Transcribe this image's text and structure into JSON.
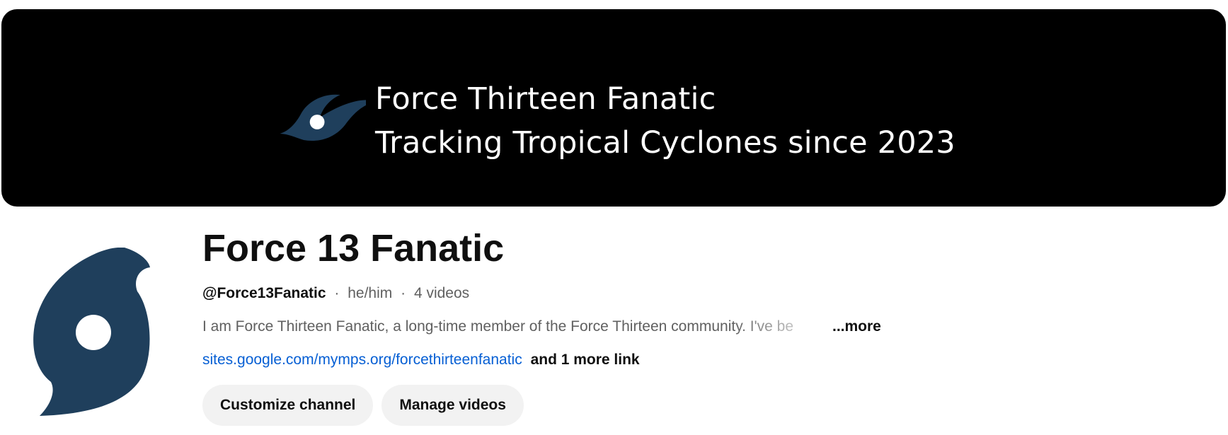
{
  "banner": {
    "line1": "Force Thirteen Fanatic",
    "line2": "Tracking Tropical Cyclones since 2023",
    "logo_icon": "hurricane-icon",
    "background_color": "#000000",
    "logo_color": "#1f3f5c"
  },
  "channel": {
    "avatar_icon": "hurricane-icon",
    "name": "Force 13 Fanatic",
    "handle": "@Force13Fanatic",
    "separator": "·",
    "pronouns": "he/him",
    "video_count": "4 videos",
    "description": "I am Force Thirteen Fanatic, a long-time member of the Force Thirteen community. I've be",
    "more_label": "...more",
    "link_url": "sites.google.com/mymps.org/forcethirteenfanatic",
    "more_links_label": "and 1 more link",
    "link_color": "#065fd4"
  },
  "actions": {
    "customize_label": "Customize channel",
    "manage_label": "Manage videos"
  }
}
